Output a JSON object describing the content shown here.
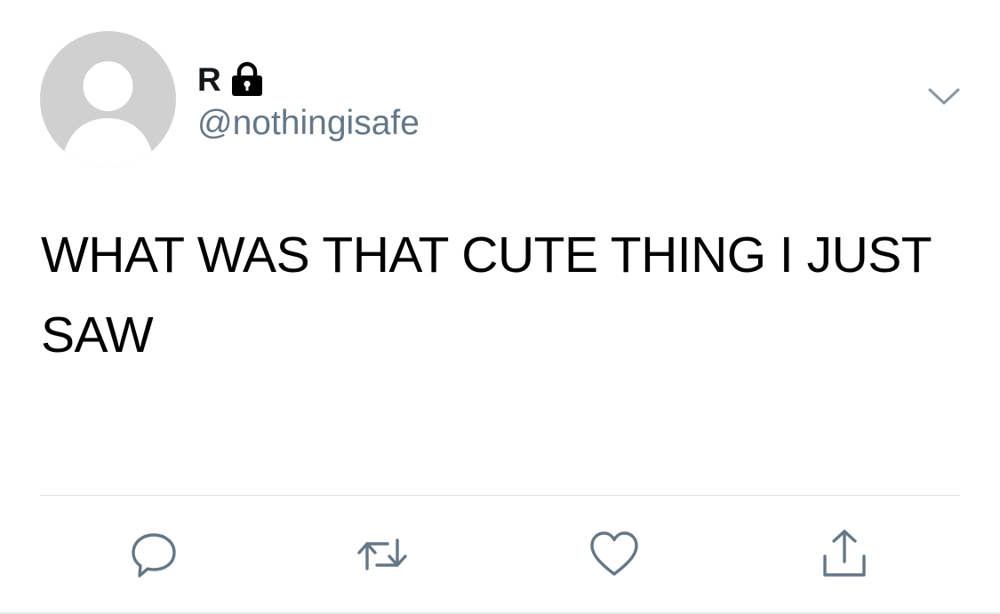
{
  "tweet": {
    "display_name": "R",
    "handle": "@nothingisafe",
    "protected": true,
    "text": "WHAT WAS THAT CUTE THING I JUST SAW"
  },
  "icons": {
    "avatar": "default-avatar-icon",
    "lock": "lock-icon",
    "menu": "chevron-down-icon",
    "reply": "reply-icon",
    "retweet": "retweet-icon",
    "like": "heart-icon",
    "share": "share-icon"
  },
  "colors": {
    "avatar_bg": "#d0d0d0",
    "handle": "#657786",
    "icons": "#657786",
    "text": "#000000"
  }
}
